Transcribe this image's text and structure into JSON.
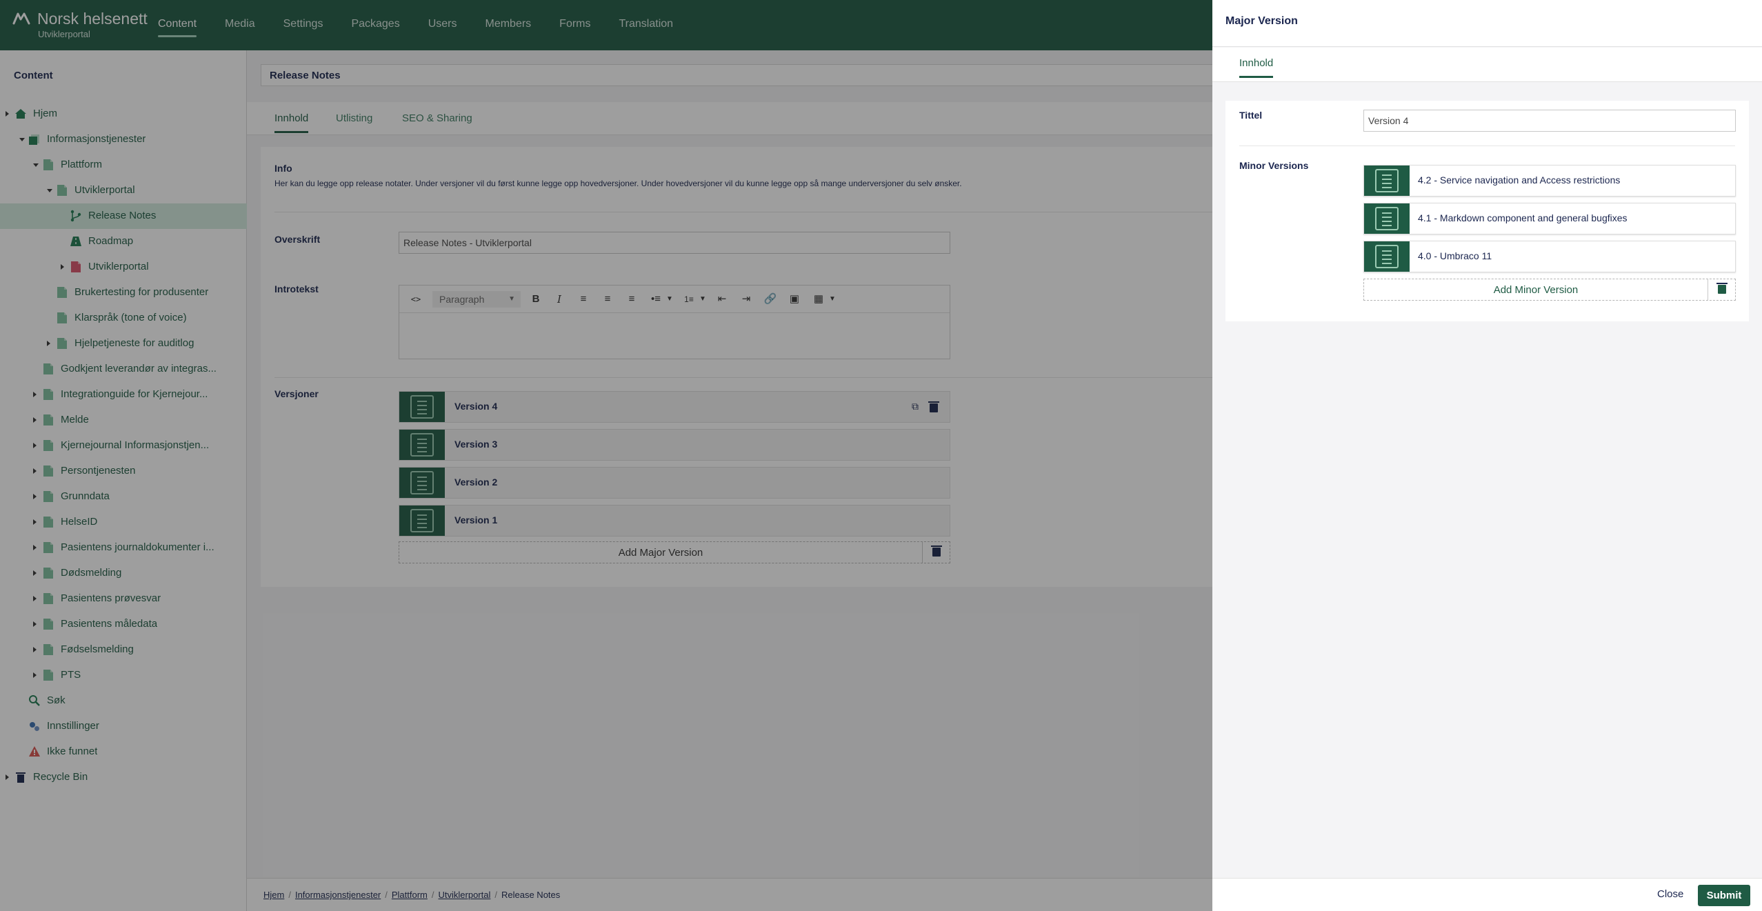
{
  "header": {
    "brand": "Norsk helsenett",
    "subtitle": "Utviklerportal",
    "nav": [
      "Content",
      "Media",
      "Settings",
      "Packages",
      "Users",
      "Members",
      "Forms",
      "Translation"
    ],
    "active_nav": "Content"
  },
  "sidebar": {
    "title": "Content",
    "items": [
      {
        "label": "Hjem",
        "icon": "home-icon"
      },
      {
        "label": "Informasjonstjenester",
        "icon": "folder-icon"
      },
      {
        "label": "Plattform",
        "icon": "document-icon"
      },
      {
        "label": "Utviklerportal",
        "icon": "document-icon"
      },
      {
        "label": "Release Notes",
        "icon": "git-branch-icon",
        "selected": true
      },
      {
        "label": "Roadmap",
        "icon": "road-icon"
      },
      {
        "label": "Utviklerportal",
        "icon": "document-red-icon"
      },
      {
        "label": "Brukertesting for produsenter",
        "icon": "document-icon"
      },
      {
        "label": "Klarspråk (tone of voice)",
        "icon": "document-icon"
      },
      {
        "label": "Hjelpetjeneste for auditlog",
        "icon": "document-icon"
      },
      {
        "label": "Godkjent leverandør av integras...",
        "icon": "document-icon"
      },
      {
        "label": "Integrationguide for Kjernejour...",
        "icon": "document-icon"
      },
      {
        "label": "Melde",
        "icon": "document-icon"
      },
      {
        "label": "Kjernejournal Informasjonstjen...",
        "icon": "document-icon"
      },
      {
        "label": "Persontjenesten",
        "icon": "document-icon"
      },
      {
        "label": "Grunndata",
        "icon": "document-icon"
      },
      {
        "label": "HelseID",
        "icon": "document-icon"
      },
      {
        "label": "Pasientens journaldokumenter i...",
        "icon": "document-icon"
      },
      {
        "label": "Dødsmelding",
        "icon": "document-icon"
      },
      {
        "label": "Pasientens prøvesvar",
        "icon": "document-icon"
      },
      {
        "label": "Pasientens måledata",
        "icon": "document-icon"
      },
      {
        "label": "Fødselsmelding",
        "icon": "document-icon"
      },
      {
        "label": "PTS",
        "icon": "document-icon"
      },
      {
        "label": "Søk",
        "icon": "search-icon"
      },
      {
        "label": "Innstillinger",
        "icon": "settings-icon"
      },
      {
        "label": "Ikke funnet",
        "icon": "warning-icon"
      },
      {
        "label": "Recycle Bin",
        "icon": "trash-icon"
      }
    ]
  },
  "main": {
    "node_name": "Release Notes",
    "tabs": [
      "Innhold",
      "Utlisting",
      "SEO & Sharing"
    ],
    "info_label": "Info",
    "info_text": "Her kan du legge opp release notater. Under versjoner vil du først kunne legge opp hovedversjoner. Under hovedversjoner vil du kunne legge opp så mange underversjoner du selv ønsker.",
    "overskrift_label": "Overskrift",
    "overskrift_value": "Release Notes - Utviklerportal",
    "introtekst_label": "Introtekst",
    "rte_format": "Paragraph",
    "versjoner_label": "Versjoner",
    "versions": [
      "Version 4",
      "Version 3",
      "Version 2",
      "Version 1"
    ],
    "add_major": "Add Major Version"
  },
  "breadcrumb": {
    "items": [
      "Hjem",
      "Informasjonstjenester",
      "Plattform",
      "Utviklerportal"
    ],
    "current": "Release Notes"
  },
  "drawer": {
    "title": "Major Version",
    "tab": "Innhold",
    "tittel_label": "Tittel",
    "tittel_value": "Version 4",
    "minor_label": "Minor Versions",
    "minor_versions": [
      "4.2 - Service navigation and Access restrictions",
      "4.1 - Markdown component and general bugfixes",
      "4.0 - Umbraco 11"
    ],
    "add_minor": "Add Minor Version",
    "close_label": "Close",
    "submit_label": "Submit"
  },
  "colors": {
    "brand": "#1f5b44",
    "selected_bg": "#d2ebdf",
    "accent_light": "#9ccbb3"
  }
}
